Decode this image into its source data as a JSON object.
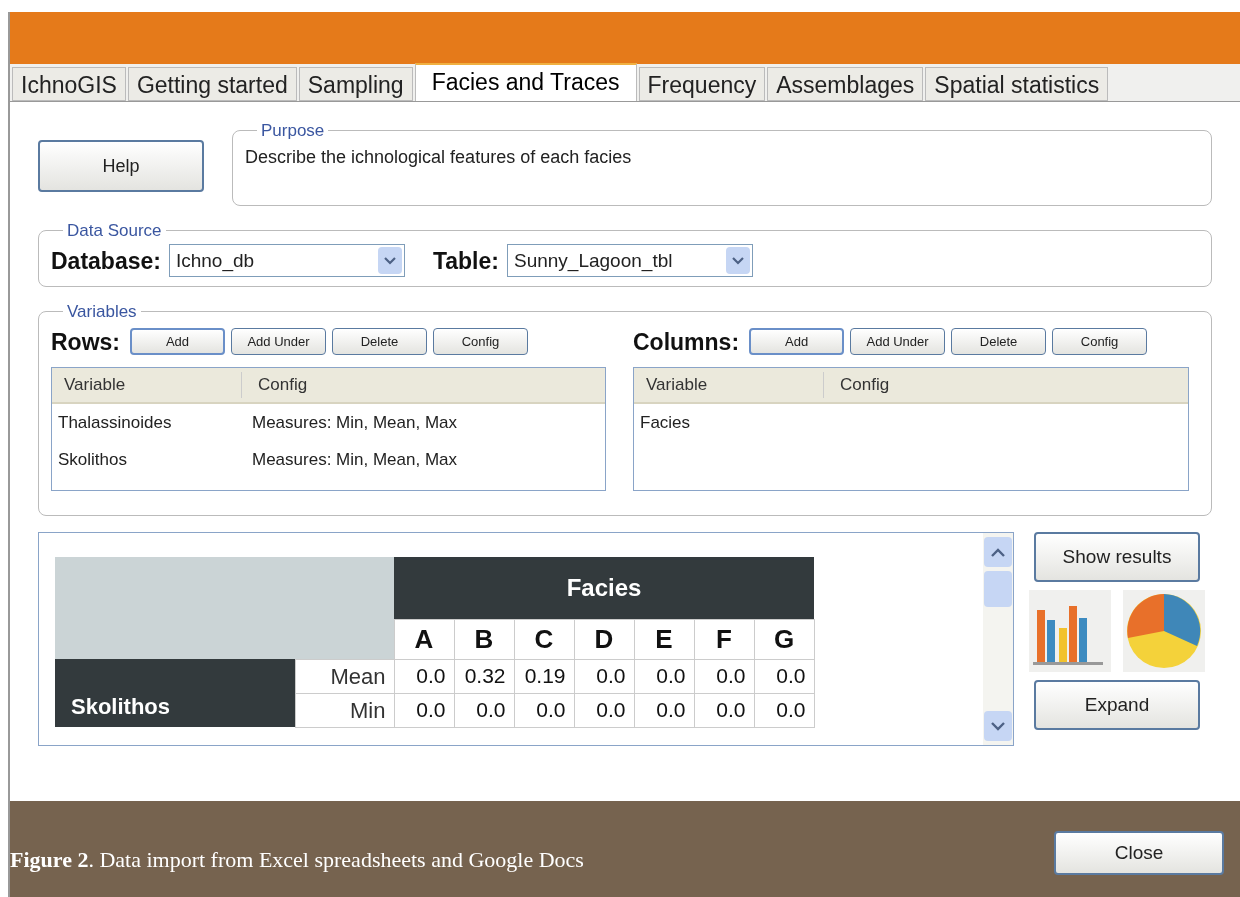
{
  "tabs": [
    {
      "label": "IchnoGIS",
      "selected": false
    },
    {
      "label": "Getting started",
      "selected": false
    },
    {
      "label": "Sampling",
      "selected": false
    },
    {
      "label": "Facies and Traces",
      "selected": true
    },
    {
      "label": "Frequency",
      "selected": false
    },
    {
      "label": "Assemblages",
      "selected": false
    },
    {
      "label": "Spatial statistics",
      "selected": false
    }
  ],
  "help_button": "Help",
  "purpose": {
    "legend": "Purpose",
    "text": "Describe the ichnological features of each facies"
  },
  "data_source": {
    "legend": "Data Source",
    "database_label": "Database:",
    "database_value": "Ichno_db",
    "table_label": "Table:",
    "table_value": "Sunny_Lagoon_tbl"
  },
  "variables": {
    "legend": "Variables",
    "panels": [
      {
        "label": "Rows:",
        "buttons": [
          "Add",
          "Add Under",
          "Delete",
          "Config"
        ],
        "columns": [
          "Variable",
          "Config"
        ],
        "items": [
          [
            "Thalassinoides",
            "Measures: Min, Mean, Max"
          ],
          [
            "Skolithos",
            "Measures: Min, Mean, Max"
          ]
        ]
      },
      {
        "label": "Columns:",
        "buttons": [
          "Add",
          "Add Under",
          "Delete",
          "Config"
        ],
        "columns": [
          "Variable",
          "Config"
        ],
        "items": [
          [
            "Facies"
          ]
        ]
      }
    ]
  },
  "results": {
    "group_header": "Facies",
    "letters": [
      "A",
      "B",
      "C",
      "D",
      "E",
      "F",
      "G"
    ],
    "row_group": "Skolithos",
    "rows": [
      {
        "measure": "Mean",
        "values": [
          "0.0",
          "0.32",
          "0.19",
          "0.0",
          "0.0",
          "0.0",
          "0.0"
        ]
      },
      {
        "measure": "Min",
        "values": [
          "0.0",
          "0.0",
          "0.0",
          "0.0",
          "0.0",
          "0.0",
          "0.0"
        ]
      }
    ]
  },
  "show_results_button": "Show results",
  "expand_button": "Expand",
  "caption": "**Figure 2**. Data import from Excel spreadsheets and Google Docs",
  "close_button": "Close"
}
